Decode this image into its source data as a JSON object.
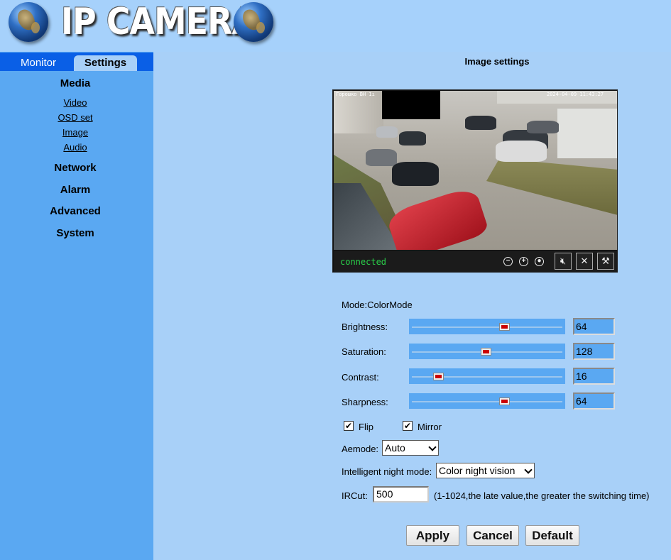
{
  "header": {
    "logo_text": "IP CAMERA"
  },
  "sidebar": {
    "tabs": [
      {
        "label": "Monitor",
        "active": false
      },
      {
        "label": "Settings",
        "active": true
      }
    ],
    "sections": [
      {
        "label": "Media",
        "links": [
          "Video",
          "OSD set",
          "Image",
          "Audio"
        ]
      },
      {
        "label": "Network"
      },
      {
        "label": "Alarm"
      },
      {
        "label": "Advanced"
      },
      {
        "label": "System"
      }
    ]
  },
  "main": {
    "title": "Image settings",
    "video": {
      "overlay_left": "Горошко ВН 1ı",
      "overlay_right": "2024-04-09 11:43:27",
      "status": "connected",
      "buttons": [
        "zoom-out",
        "zoom-in",
        "record",
        "mute",
        "mic-off",
        "settings"
      ]
    },
    "mode_label": "Mode:ColorMode",
    "sliders": [
      {
        "label": "Brightness:",
        "value": "64",
        "fraction": 0.63
      },
      {
        "label": "Saturation:",
        "value": "128",
        "fraction": 0.5
      },
      {
        "label": "Contrast:",
        "value": "16",
        "fraction": 0.17
      },
      {
        "label": "Sharpness:",
        "value": "64",
        "fraction": 0.63
      }
    ],
    "flip": {
      "label": "Flip",
      "checked": true
    },
    "mirror": {
      "label": "Mirror",
      "checked": true
    },
    "aemode": {
      "label": "Aemode:",
      "value": "Auto"
    },
    "night_mode": {
      "label": "Intelligent night mode:",
      "value": "Color night vision"
    },
    "ircut": {
      "label": "IRCut:",
      "value": "500",
      "hint": "(1-1024,the late value,the greater the switching time)"
    },
    "buttons": {
      "apply": "Apply",
      "cancel": "Cancel",
      "default": "Default"
    },
    "colors": {
      "sidebar": "#5aa8f2",
      "tabbar": "#0a5fe6",
      "background": "#a8d0f8",
      "slider_thumb": "#cc0000",
      "status_text": "#2ad14a"
    }
  }
}
